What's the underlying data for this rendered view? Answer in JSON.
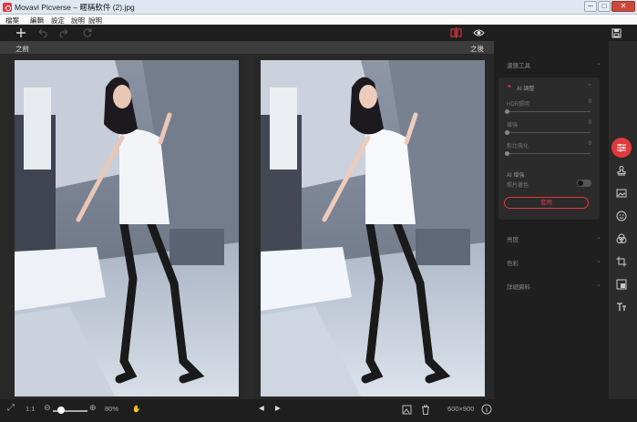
{
  "window": {
    "title": "Movavi Picverse – 暱稱軟件 (2).jpg",
    "controls": {
      "minimize": "─",
      "maximize": "□",
      "close": "✕"
    }
  },
  "menu": [
    "檔案",
    "編輯",
    "設定",
    "說明",
    "說明"
  ],
  "toolbar": {
    "icons": [
      "plus-icon",
      "undo-icon",
      "redo-icon",
      "reset-icon",
      "compare-split-icon",
      "eye-icon",
      "save-icon"
    ]
  },
  "labels": {
    "before": "之前",
    "after": "之後"
  },
  "bottom": {
    "fit_glyph": "⤢",
    "zoom_one": "1:1",
    "zoom_value": "80%",
    "dimensions": "600×900",
    "prev": "◀",
    "next": "▶"
  },
  "panel": {
    "sections": [
      "濾鏡工具",
      "亮度",
      "色彩",
      "詳細資料"
    ],
    "ai": {
      "title": "AI 調整",
      "sliders": [
        {
          "label": "HDR照明",
          "value": "0",
          "fraction": 0.0
        },
        {
          "label": "增強",
          "value": "0",
          "fraction": 0.0
        },
        {
          "label": "對比強化",
          "value": "0",
          "fraction": 0.0
        }
      ],
      "ai_label": "AI 增強",
      "toggle_label": "照片著色",
      "apply": "套用"
    }
  },
  "colors": {
    "accent": "#e0393e",
    "panel": "#1f1f1f",
    "toolbar": "#1e1e1e"
  }
}
